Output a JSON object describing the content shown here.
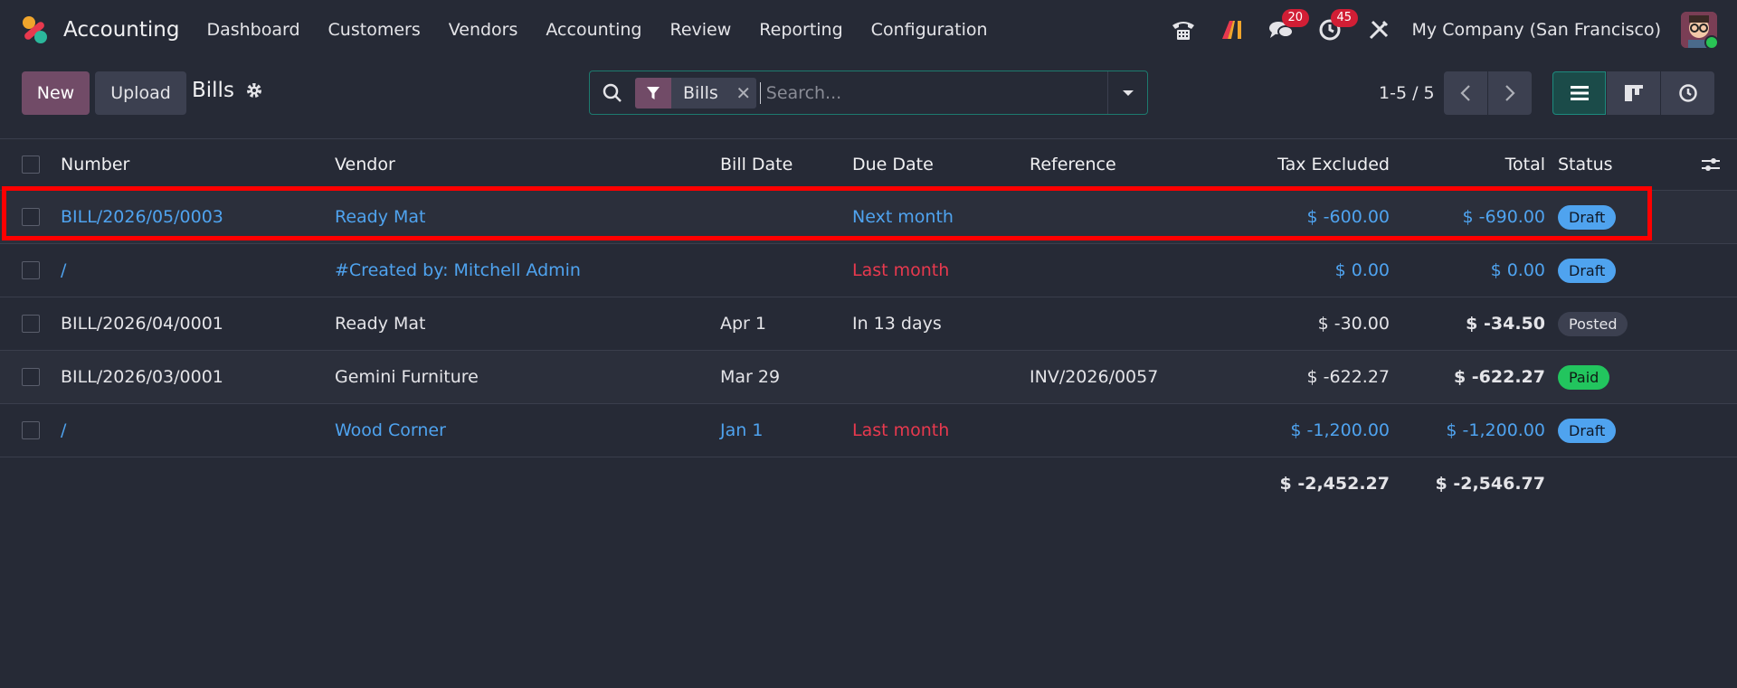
{
  "navbar": {
    "app_name": "Accounting",
    "menu": [
      "Dashboard",
      "Customers",
      "Vendors",
      "Accounting",
      "Review",
      "Reporting",
      "Configuration"
    ],
    "messages_badge": "20",
    "activities_badge": "45",
    "company": "My Company (San Francisco)",
    "icons": [
      "phone-icon",
      "ai-icon",
      "chat-icon",
      "clock-icon",
      "tools-icon"
    ]
  },
  "control": {
    "new_label": "New",
    "upload_label": "Upload",
    "title": "Bills",
    "facet_label": "Bills",
    "search_placeholder": "Search...",
    "pager": "1-5 / 5"
  },
  "table": {
    "headers": {
      "number": "Number",
      "vendor": "Vendor",
      "bill_date": "Bill Date",
      "due_date": "Due Date",
      "reference": "Reference",
      "tax_excluded": "Tax Excluded",
      "total": "Total",
      "status": "Status"
    },
    "rows": [
      {
        "number": "BILL/2026/05/0003",
        "vendor": "Ready Mat",
        "bill_date": "",
        "due_date": "Next month",
        "reference": "",
        "tax_excluded": "$ -600.00",
        "total": "$ -690.00",
        "status": "Draft"
      },
      {
        "number": "/",
        "vendor": "#Created by: Mitchell Admin",
        "bill_date": "",
        "due_date": "Last month",
        "reference": "",
        "tax_excluded": "$ 0.00",
        "total": "$ 0.00",
        "status": "Draft"
      },
      {
        "number": "BILL/2026/04/0001",
        "vendor": "Ready Mat",
        "bill_date": "Apr 1",
        "due_date": "In 13 days",
        "reference": "",
        "tax_excluded": "$ -30.00",
        "total": "$ -34.50",
        "status": "Posted"
      },
      {
        "number": "BILL/2026/03/0001",
        "vendor": "Gemini Furniture",
        "bill_date": "Mar 29",
        "due_date": "",
        "reference": "INV/2026/0057",
        "tax_excluded": "$ -622.27",
        "total": "$ -622.27",
        "status": "Paid"
      },
      {
        "number": "/",
        "vendor": "Wood Corner",
        "bill_date": "Jan 1",
        "due_date": "Last month",
        "reference": "",
        "tax_excluded": "$ -1,200.00",
        "total": "$ -1,200.00",
        "status": "Draft"
      }
    ],
    "totals": {
      "tax_excluded": "$ -2,452.27",
      "total": "$ -2,546.77"
    }
  },
  "colors": {
    "accent": "#714b67",
    "link": "#4fa3ef",
    "danger": "#e8394e",
    "paid": "#22c55e",
    "highlight": "#ff0000"
  }
}
